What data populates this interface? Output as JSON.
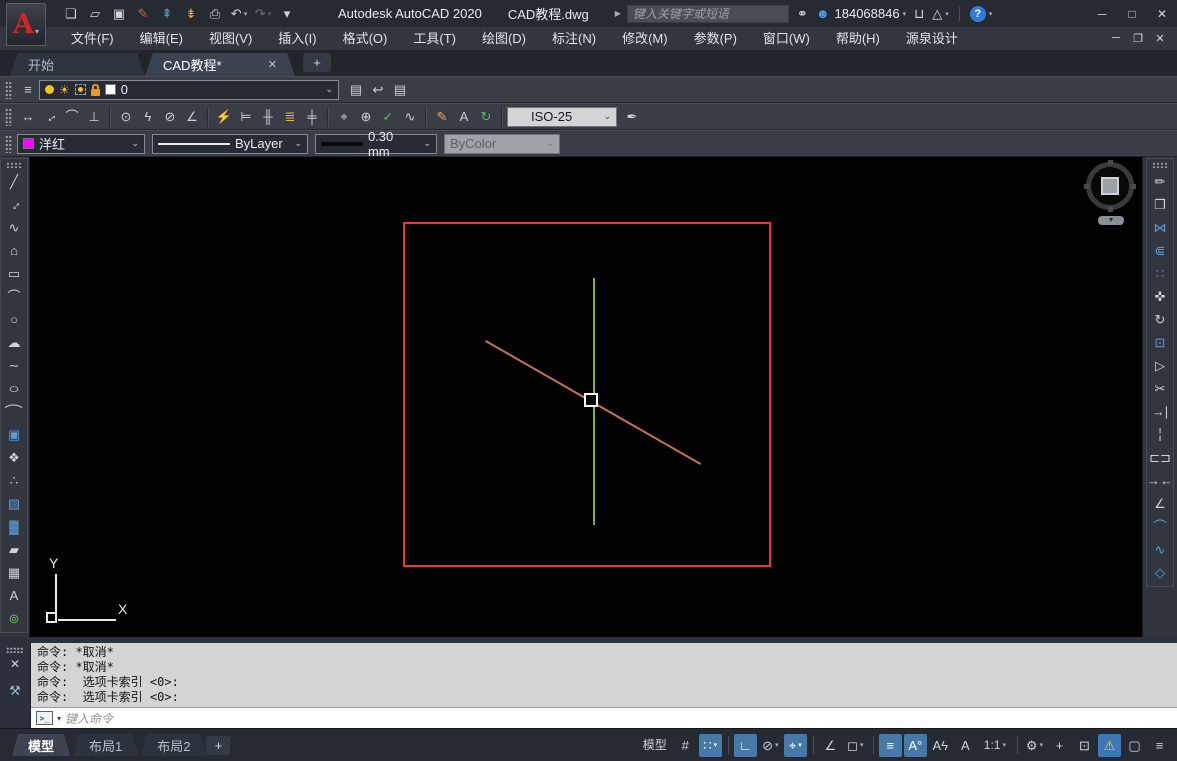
{
  "titlebar": {
    "logo_letter": "A",
    "app_title": "Autodesk AutoCAD 2020",
    "doc_title": "CAD教程.dwg",
    "search_placeholder": "键入关键字或短语",
    "user_id": "184068846",
    "icons": {
      "logo_dd": "▾",
      "search_expand": "▶",
      "binoculars": "⚭",
      "user": "☻",
      "dd": "▾",
      "cart": "⊔",
      "a360": "△",
      "help": "?",
      "win_min": "─",
      "win_max": "□",
      "win_close": "✕"
    },
    "qat": [
      {
        "name": "new-file-icon",
        "glyph": "❏"
      },
      {
        "name": "open-file-icon",
        "glyph": "▱"
      },
      {
        "name": "save-icon",
        "glyph": "▣"
      },
      {
        "name": "save-as-icon",
        "glyph": "✎",
        "c": "r"
      },
      {
        "name": "open-web-mobile-icon",
        "glyph": "⇞",
        "c": "b"
      },
      {
        "name": "save-web-mobile-icon",
        "glyph": "⇟",
        "c": "y"
      },
      {
        "name": "plot-icon",
        "glyph": "⎙"
      },
      {
        "name": "undo-icon",
        "glyph": "↶",
        "dd": "▾"
      },
      {
        "name": "redo-icon",
        "glyph": "↷",
        "dd": "▾",
        "disabled": true
      },
      {
        "name": "qat-customize-icon",
        "glyph": "▾"
      }
    ]
  },
  "menubar": {
    "items": [
      "文件(F)",
      "编辑(E)",
      "视图(V)",
      "插入(I)",
      "格式(O)",
      "工具(T)",
      "绘图(D)",
      "标注(N)",
      "修改(M)",
      "参数(P)",
      "窗口(W)",
      "帮助(H)",
      "源泉设计"
    ],
    "doc_controls": {
      "min": "─",
      "restore": "❐",
      "close": "✕"
    }
  },
  "file_tabs": {
    "start_tab": "开始",
    "active_tab": "CAD教程*",
    "close_glyph": "✕",
    "plus_glyph": "+"
  },
  "layers_toolbar": {
    "current_layer": "0",
    "chevron": "⌄",
    "panel_icon_glyph": "≡",
    "right_tools": [
      {
        "name": "make-object-layer-current-icon",
        "glyph": "▤"
      },
      {
        "name": "layer-previous-icon",
        "glyph": "↩"
      },
      {
        "name": "layer-states-manager-icon",
        "glyph": "▤"
      }
    ]
  },
  "dim_toolbar": {
    "style": "ISO-25",
    "chevron": "⌄",
    "style_tool_glyph": "✒",
    "tools": [
      {
        "name": "linear-dimension-icon",
        "glyph": "↔"
      },
      {
        "name": "aligned-dimension-icon",
        "glyph": "↔",
        "rot": -35
      },
      {
        "name": "arc-length-icon",
        "glyph": "⌒"
      },
      {
        "name": "ordinate-icon",
        "glyph": "⊥"
      },
      {
        "sep": true
      },
      {
        "name": "radius-icon",
        "glyph": "⊙"
      },
      {
        "name": "jogged-icon",
        "glyph": "ϟ"
      },
      {
        "name": "diameter-icon",
        "glyph": "⊘"
      },
      {
        "name": "angular-icon",
        "glyph": "∠"
      },
      {
        "sep": true
      },
      {
        "name": "quick-dim-icon",
        "glyph": "⚡",
        "c": "y"
      },
      {
        "name": "baseline-dim-icon",
        "glyph": "⊨"
      },
      {
        "name": "continue-dim-icon",
        "glyph": "╫"
      },
      {
        "name": "dim-space-icon",
        "glyph": "≣",
        "c": "y"
      },
      {
        "name": "dim-break-icon",
        "glyph": "╪"
      },
      {
        "sep": true
      },
      {
        "name": "tolerance-icon",
        "glyph": "⌖"
      },
      {
        "name": "center-mark-icon",
        "glyph": "⊕"
      },
      {
        "name": "dim-inspect-icon",
        "glyph": "✓",
        "c": "g"
      },
      {
        "name": "dim-jogline-icon",
        "glyph": "∿"
      },
      {
        "sep": true
      },
      {
        "name": "dim-edit-icon",
        "glyph": "✎",
        "c": "y"
      },
      {
        "name": "dim-text-edit-icon",
        "glyph": "A"
      },
      {
        "name": "dim-update-icon",
        "glyph": "↻",
        "c": "g"
      },
      {
        "sep": true
      }
    ]
  },
  "properties_toolbar": {
    "color_name": "洋红",
    "color_hex": "#ff00ff",
    "linetype": "ByLayer",
    "lineweight": "0.30 mm",
    "plot_style": "ByColor",
    "chevron": "⌄"
  },
  "draw_toolbar": [
    {
      "name": "line-icon",
      "glyph": "╱"
    },
    {
      "name": "construction-line-icon",
      "glyph": "↔",
      "rot": -45
    },
    {
      "name": "polyline-icon",
      "glyph": "∿"
    },
    {
      "name": "polygon-icon",
      "glyph": "⌂"
    },
    {
      "name": "rectangle-icon",
      "glyph": "▭"
    },
    {
      "name": "arc-icon",
      "glyph": "⌒"
    },
    {
      "name": "circle-icon",
      "glyph": "○"
    },
    {
      "name": "revision-cloud-icon",
      "glyph": "☁"
    },
    {
      "name": "spline-icon",
      "glyph": "∼"
    },
    {
      "name": "ellipse-icon",
      "glyph": "○",
      "stretch": true
    },
    {
      "name": "ellipse-arc-icon",
      "glyph": "⌒",
      "stretch": true
    },
    {
      "name": "insert-block-icon",
      "glyph": "▣",
      "c": "b"
    },
    {
      "name": "create-block-icon",
      "glyph": "❖"
    },
    {
      "name": "point-icon",
      "glyph": "∴"
    },
    {
      "name": "hatch-icon",
      "glyph": "▨",
      "c": "b"
    },
    {
      "name": "gradient-icon",
      "glyph": "▓",
      "c": "b"
    },
    {
      "name": "region-icon",
      "glyph": "▰"
    },
    {
      "name": "table-icon",
      "glyph": "▦"
    },
    {
      "name": "mtext-icon",
      "glyph": "A"
    },
    {
      "name": "add-selected-icon",
      "glyph": "⊚",
      "c": "g"
    }
  ],
  "modify_toolbar": [
    {
      "name": "erase-icon",
      "glyph": "✏"
    },
    {
      "name": "copy-icon",
      "glyph": "❐"
    },
    {
      "name": "mirror-icon",
      "glyph": "⋈",
      "c": "b"
    },
    {
      "name": "offset-icon",
      "glyph": "⋐",
      "c": "b"
    },
    {
      "name": "array-icon",
      "glyph": "∷",
      "c": "b"
    },
    {
      "name": "move-icon",
      "glyph": "✜"
    },
    {
      "name": "rotate-icon",
      "glyph": "↻"
    },
    {
      "name": "scale-icon",
      "glyph": "⊡",
      "c": "b"
    },
    {
      "name": "stretch-icon",
      "glyph": "▷"
    },
    {
      "name": "trim-icon",
      "glyph": "✂"
    },
    {
      "name": "extend-icon",
      "glyph": "→|"
    },
    {
      "name": "break-at-point-icon",
      "glyph": "╎"
    },
    {
      "name": "break-icon",
      "glyph": "⊏⊐"
    },
    {
      "name": "join-icon",
      "glyph": "→←"
    },
    {
      "name": "chamfer-icon",
      "glyph": "∠"
    },
    {
      "name": "fillet-icon",
      "glyph": "⌒",
      "c": "b"
    },
    {
      "name": "blend-icon",
      "glyph": "∿",
      "c": "b"
    },
    {
      "name": "explode-icon",
      "glyph": "◇",
      "c": "b"
    }
  ],
  "command_panel": {
    "history": [
      "命令: *取消*",
      "命令: *取消*",
      "命令:  选项卡索引 <0>:",
      "命令:  选项卡索引 <0>:"
    ],
    "input_placeholder": "键入命令",
    "prompt_glyph": ">_",
    "dropdown_glyph": "▾",
    "close_glyph": "✕",
    "wrench_glyph": "⚒"
  },
  "status_bar": {
    "layout_tabs": [
      {
        "name": "layout-tab-model",
        "label": "模型",
        "active": true
      },
      {
        "name": "layout-tab-layout1",
        "label": "布局1"
      },
      {
        "name": "layout-tab-layout2",
        "label": "布局2"
      }
    ],
    "new_layout_glyph": "+",
    "buttons": [
      {
        "name": "model-space-button",
        "glyph": "模型",
        "txt": true
      },
      {
        "name": "grid-icon",
        "glyph": "#"
      },
      {
        "name": "snap-icon",
        "glyph": "∷",
        "active": true,
        "dd": "▾"
      },
      {
        "sep": true
      },
      {
        "name": "ortho-icon",
        "glyph": "∟",
        "active": true
      },
      {
        "name": "polar-tracking-icon",
        "glyph": "⊘",
        "dd": "▾"
      },
      {
        "name": "osnap-icon",
        "glyph": "⌖",
        "active": true,
        "dd": "▾"
      },
      {
        "sep": true
      },
      {
        "name": "isodraft-icon",
        "glyph": "∠"
      },
      {
        "name": "otrack-icon",
        "glyph": "◻",
        "dd": "▾"
      },
      {
        "sep": true
      },
      {
        "name": "lineweight-display-icon",
        "glyph": "≡",
        "active": true
      },
      {
        "name": "annotation-visibility-icon",
        "glyph": "A°",
        "active": true
      },
      {
        "name": "auto-annotation-scale-icon",
        "glyph": "Aϟ"
      },
      {
        "name": "annotation-scale-icon",
        "glyph": "A"
      },
      {
        "name": "annotation-scale-value",
        "glyph": "1:1",
        "txt": true,
        "dd": "▾"
      },
      {
        "sep": true
      },
      {
        "name": "workspace-gear-icon",
        "glyph": "⚙",
        "dd": "▾"
      },
      {
        "name": "crosshair-plus-icon",
        "glyph": "+"
      },
      {
        "name": "isolate-objects-icon",
        "glyph": "⊡"
      },
      {
        "name": "hardware-acceleration-icon",
        "glyph": "⚠",
        "warn": true
      },
      {
        "name": "clean-screen-icon",
        "glyph": "▢"
      },
      {
        "name": "customization-icon",
        "glyph": "≡"
      }
    ]
  },
  "ucs": {
    "x_label": "X",
    "y_label": "Y"
  },
  "drawing": {
    "entities": [
      {
        "type": "selection-window",
        "color": "#e8383c"
      },
      {
        "type": "vertical-line",
        "color": "#7ab143"
      },
      {
        "type": "diagonal-line",
        "color": "#c07453"
      },
      {
        "type": "pickbox-cursor",
        "color": "#ffffff"
      }
    ]
  }
}
